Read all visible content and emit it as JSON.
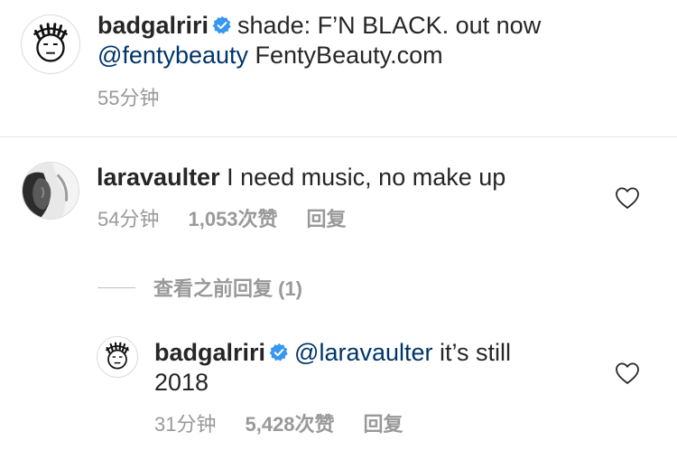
{
  "post": {
    "username": "badgalriri",
    "caption_text": "shade: F’N BLACK. out now",
    "caption_mention": "@fentybeauty",
    "caption_link": "FentyBeauty.com",
    "time": "55分钟"
  },
  "comment": {
    "username": "laravaulter",
    "text": "I need music, no make up",
    "time": "54分钟",
    "likes": "1,053次赞",
    "reply_label": "回复"
  },
  "view_previous_replies": "查看之前回复 (1)",
  "reply": {
    "username": "badgalriri",
    "mention": "@laravaulter",
    "text_line1": "it’s still",
    "text_line2": "2018",
    "time": "31分钟",
    "likes": "5,428次赞",
    "reply_label": "回复"
  },
  "icons": {
    "verified": "verified-badge-icon",
    "like": "heart-outline-icon"
  },
  "colors": {
    "text": "#262626",
    "mention": "#003569",
    "meta": "#999999",
    "verified": "#3897f0"
  }
}
